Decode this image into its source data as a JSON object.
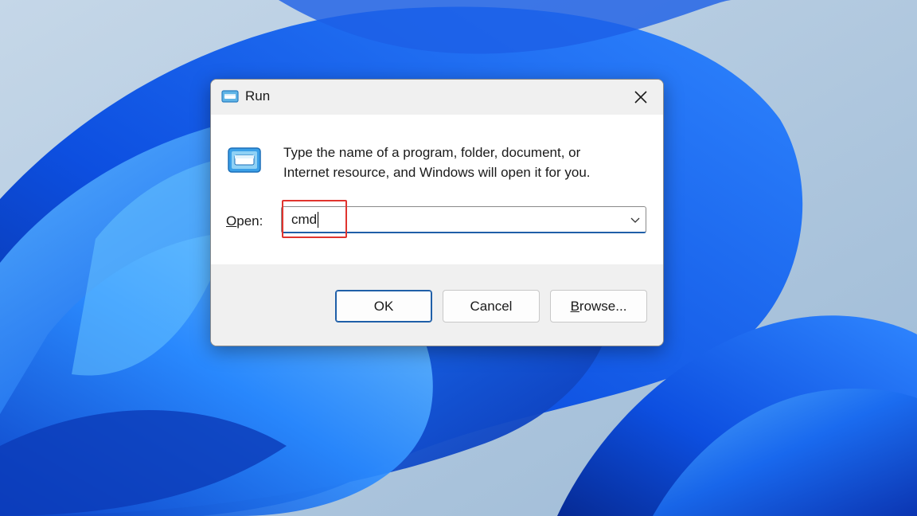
{
  "dialog": {
    "title": "Run",
    "description_line1": "Type the name of a program, folder, document, or",
    "description_line2": "Internet resource, and Windows will open it for you.",
    "open_label_mnemonic": "O",
    "open_label_rest": "pen:",
    "open_value": "cmd",
    "ok_label": "OK",
    "cancel_label": "Cancel",
    "browse_mnemonic": "B",
    "browse_rest": "rowse..."
  },
  "icons": {
    "title_icon": "run-icon",
    "big_icon": "run-icon",
    "close_icon": "close-icon",
    "dropdown_icon": "chevron-down-icon"
  },
  "colors": {
    "accent": "#1f5fa8",
    "highlight": "#e0342e",
    "wallpaper_blue": "#0a4fd6"
  }
}
